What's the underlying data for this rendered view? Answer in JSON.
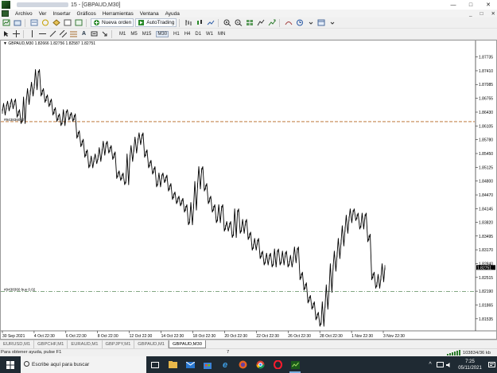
{
  "window": {
    "title": "15 - [GBPAUD,M30]",
    "controls": [
      "—",
      "□",
      "✕"
    ]
  },
  "menu": {
    "items": [
      "Archivo",
      "Ver",
      "Insertar",
      "Gráficos",
      "Herramientas",
      "Ventana",
      "Ayuda"
    ],
    "right_controls": [
      "_",
      "□",
      "✕"
    ]
  },
  "toolbar": {
    "new_order_label": "Nueva orden",
    "autotrading_label": "AutoTrading",
    "timeframes": [
      "M1",
      "M5",
      "M15",
      "M30",
      "H1",
      "H4",
      "D1",
      "W1",
      "MN"
    ],
    "active_timeframe": "M30"
  },
  "chart": {
    "header": "GBPAUD,M30  1.82666 1.82756 1.82587 1.82751",
    "symbol": "GBPAUD",
    "timeframe": "M30",
    "ohlc": {
      "open": 1.82666,
      "high": 1.82756,
      "low": 1.82587,
      "close": 1.82751
    },
    "price_marker": "1.82751",
    "orders": [
      {
        "label": "#9438360 buy 0.02",
        "price": 1.82185
      },
      {
        "label": "#9438360 sl",
        "price": 1.86205
      }
    ]
  },
  "chart_data": {
    "type": "line",
    "title": "GBPAUD,M30  1.82666 1.82756 1.82587 1.82751",
    "x_tick_labels": [
      "30 Sep 2021",
      "4 Oct 22:30",
      "6 Oct 22:30",
      "8 Oct 22:30",
      "12 Oct 22:30",
      "14 Oct 22:30",
      "18 Oct 22:30",
      "20 Oct 22:30",
      "22 Oct 22:30",
      "26 Oct 22:30",
      "28 Oct 22:30",
      "1 Nov 22:30",
      "3 Nov 22:30"
    ],
    "y_ticks": [
      1.87735,
      1.8741,
      1.87085,
      1.86755,
      1.8643,
      1.86105,
      1.8578,
      1.8545,
      1.85125,
      1.848,
      1.8447,
      1.84145,
      1.8382,
      1.83495,
      1.8317,
      1.8284,
      1.82515,
      1.8219,
      1.81865,
      1.81535
    ],
    "y_tick_labels": [
      "1.87735",
      "1.87410",
      "1.87085",
      "1.86755",
      "1.86430",
      "1.86105",
      "1.85780",
      "1.85450",
      "1.85125",
      "1.84800",
      "1.84470",
      "1.84145",
      "1.83820",
      "1.83495",
      "1.83170",
      "1.82840",
      "1.82515",
      "1.82190",
      "1.81865",
      "1.81535"
    ],
    "y_axis_labels_shown": [
      "1.87735",
      "1.87410",
      "1.87085",
      "1.86755",
      "1.86430",
      "1.86105",
      "1.85780",
      "1.85450",
      "1.85125",
      "1.84800",
      "1.84470",
      "1.84145",
      "1.83820",
      "1.83495",
      "1.83170",
      "1.82840",
      "1.82515",
      "1.82190",
      "1.81865",
      "1.81535"
    ],
    "ylim": [
      1.8125,
      1.8805
    ],
    "x": [
      0,
      1,
      2,
      3,
      4,
      5,
      6,
      7,
      8,
      9,
      10,
      11,
      12,
      13,
      14,
      15,
      16,
      17,
      18,
      19,
      20,
      21,
      22,
      23,
      24,
      25,
      26,
      27,
      28,
      29,
      30,
      31,
      32,
      33,
      34,
      35,
      36,
      37,
      38,
      39,
      40,
      41,
      42,
      43,
      44,
      45,
      46,
      47,
      48,
      49,
      50,
      51,
      52,
      53,
      54,
      55,
      56,
      57,
      58,
      59,
      60,
      61,
      62,
      63,
      64,
      65,
      66,
      67,
      68,
      69,
      70,
      71,
      72,
      73,
      74,
      75,
      76,
      77,
      78,
      79,
      80,
      81,
      82,
      83,
      84,
      85,
      86,
      87,
      88,
      89,
      90,
      91,
      92,
      93,
      94,
      95,
      96
    ],
    "series": [
      {
        "color": "#000000",
        "values": [
          1.8645,
          1.8655,
          1.866,
          1.8665,
          1.864,
          1.8625,
          1.867,
          1.869,
          1.8705,
          1.8735,
          1.869,
          1.8675,
          1.8665,
          1.8645,
          1.863,
          1.862,
          1.864,
          1.8633,
          1.863,
          1.859,
          1.857,
          1.8545,
          1.852,
          1.853,
          1.8535,
          1.855,
          1.8565,
          1.8555,
          1.854,
          1.8495,
          1.849,
          1.848,
          1.8535,
          1.8555,
          1.8575,
          1.8585,
          1.8545,
          1.852,
          1.8505,
          1.8475,
          1.849,
          1.8485,
          1.8465,
          1.8445,
          1.8435,
          1.843,
          1.8415,
          1.8385,
          1.842,
          1.847,
          1.8505,
          1.8465,
          1.8435,
          1.8415,
          1.839,
          1.8415,
          1.837,
          1.8375,
          1.8355,
          1.8405,
          1.8365,
          1.838,
          1.835,
          1.8325,
          1.8335,
          1.8305,
          1.829,
          1.83,
          1.8285,
          1.831,
          1.829,
          1.8305,
          1.8285,
          1.8295,
          1.8315,
          1.8255,
          1.823,
          1.82,
          1.8185,
          1.816,
          1.8145,
          1.8185,
          1.8225,
          1.8275,
          1.8305,
          1.8335,
          1.8365,
          1.839,
          1.8405,
          1.8395,
          1.8375,
          1.8395,
          1.8345,
          1.8255,
          1.8235,
          1.825,
          1.8275
        ]
      }
    ],
    "horizontal_lines": [
      {
        "label": "#9438360 sl",
        "value": 1.86205,
        "color": "#b5651d",
        "style": "dashed"
      },
      {
        "label": "#9438360 buy 0.02",
        "value": 1.82185,
        "color": "#5a8a5a",
        "style": "dash-dot"
      }
    ],
    "current_price": 1.82751,
    "grid": false
  },
  "tabs": {
    "items": [
      "EURUSD,M1",
      "GBPCHF,M1",
      "EURAUD,M1",
      "GBPJPY,M1",
      "GBPAUD,M1",
      "GBPAUD,M30"
    ],
    "active": "GBPAUD,M30"
  },
  "status": {
    "help_text": "Para obtener ayuda, pulse F1",
    "middle_value": "7",
    "connection": "103834/36 kb"
  },
  "taskbar": {
    "search_placeholder": "Escribe aquí para buscar",
    "time": "7:25",
    "date": "05/11/2021"
  },
  "colors": {
    "chart_line": "#000000",
    "sl_line": "#b5651d",
    "buy_line": "#5a8a5a",
    "taskbar": "#1f2a33"
  }
}
